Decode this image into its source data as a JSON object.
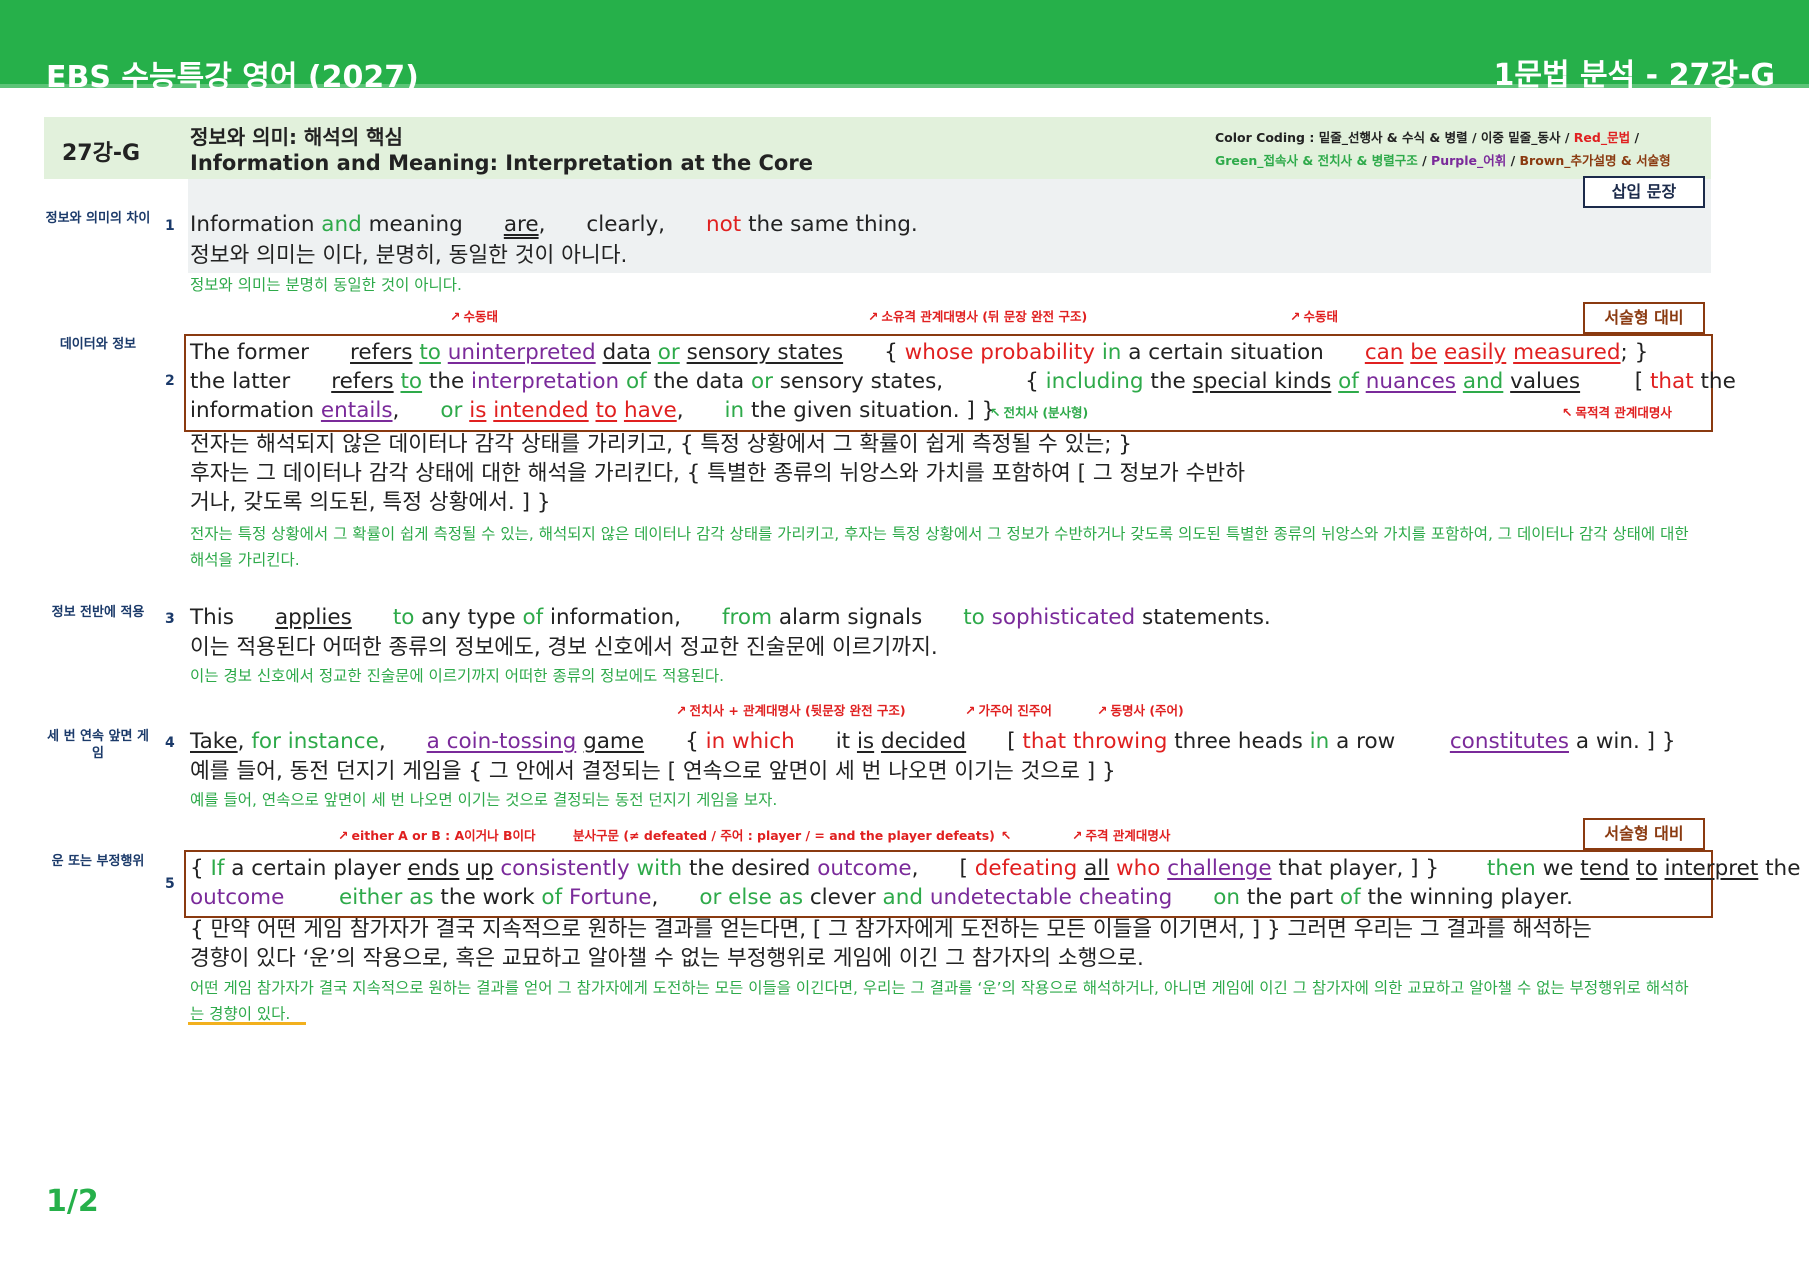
{
  "header": {
    "doc_title": "EBS 수능특강 영어 (2027)",
    "section_title": "1문법 분석 - 27강-G"
  },
  "lesson": {
    "label": "27강-G",
    "title_ko": "정보와 의미: 해석의 핵심",
    "title_en": "Information and Meaning: Interpretation at the Core"
  },
  "color_coding": {
    "line1_black": "Color Coding : 밑줄_선행사 & 수식 & 병렬 / 이중 밑줄_동사 / ",
    "line1_red": "Red_문법",
    "line1_end": " /",
    "line2_green": "Green_접속사 & 전치사 & 병렬구조",
    "sep1": " / ",
    "line2_purple": "Purple_어휘",
    "sep2": " / ",
    "line2_brown": "Brown_추가설명 & 서술형",
    "colors": {
      "green": "#2eaa4a",
      "red": "#e02020",
      "purple": "#7a2a9a",
      "brown": "#8a3a10",
      "navy": "#1b2a4a"
    }
  },
  "tags": {
    "insert": "삽입 문장",
    "essay": "서술형 대비"
  },
  "s1": {
    "topic": "정보와 의미의 차이",
    "num": "1",
    "en": [
      "Information ",
      "and",
      " meaning      ",
      "are",
      ",      clearly,      ",
      "not",
      " the same thing."
    ],
    "ko": [
      "정보와 의미는                       이다,      분명히,       동일한 것이 아니다."
    ],
    "trans": "정보와 의미는 분명히 동일한 것이 아니다."
  },
  "s2": {
    "topic": "데이터와 정보",
    "num": "2",
    "notes": [
      "수동태",
      "소유격 관계대명사 (뒤 문장 완전 구조)",
      "수동태",
      "전치사 (분사형)",
      "목적격 관계대명사"
    ],
    "l1": [
      "The former      ",
      "refers",
      " ",
      "to",
      " ",
      "uninterpreted",
      " ",
      "data",
      " ",
      "or",
      " ",
      "sensory states",
      "      { ",
      "whose probability",
      " ",
      "in",
      " a certain situation      ",
      "can",
      " ",
      "be",
      " ",
      "easily",
      " ",
      "measured",
      "; }"
    ],
    "l2": [
      "the latter      ",
      "refers",
      " ",
      "to",
      " the ",
      "interpretation",
      " ",
      "of",
      " the data ",
      "or",
      " sensory states,            { ",
      "including",
      " the ",
      "special kinds",
      " ",
      "of",
      " ",
      "nuances",
      " ",
      "and",
      " ",
      "values",
      "        [ ",
      "that",
      " the"
    ],
    "l3": [
      "information ",
      "entails",
      ",      ",
      "or",
      " ",
      "is",
      " ",
      "intended",
      " ",
      "to",
      " ",
      "have",
      ",      ",
      "in",
      " the given situation. ] }"
    ],
    "ko1": "전자는             해석되지 않은 데이터나 감각 상태를 가리키고,             { 특정 상황에서 그 확률이                              쉽게 측정될 수 있는; }",
    "ko2": "후자는          그 데이터나 감각 상태에 대한 해석을 가리킨다,                            { 특별한 종류의 뉘앙스와 가치를 포함하여                            [ 그 정보가 수반하",
    "ko3": "거나,                 갖도록 의도된,                    특정 상황에서. ] }",
    "trans": "전자는 특정 상황에서 그 확률이 쉽게 측정될 수 있는, 해석되지 않은 데이터나 감각 상태를 가리키고, 후자는 특정 상황에서 그 정보가 수반하거나 갖도록 의도된 특별한 종류의 뉘앙스와 가치를 포함하여, 그 데이터나 감각 상태에 대한 해석을 가리킨다."
  },
  "s3": {
    "topic": "정보 전반에 적용",
    "num": "3",
    "en": [
      "This      ",
      "applies",
      "      ",
      "to",
      " any type ",
      "of",
      " information,      ",
      "from",
      " alarm signals      ",
      "to",
      " ",
      "sophisticated",
      " statements."
    ],
    "ko": "이는       적용된다      어떠한 종류의 정보에도,              경보 신호에서              정교한 진술문에 이르기까지.",
    "trans": "이는 경보 신호에서 정교한 진술문에 이르기까지 어떠한 종류의 정보에도 적용된다."
  },
  "s4": {
    "topic": "세 번 연속 앞면 게임",
    "num": "4",
    "notes": [
      "전치사 + 관계대명사 (뒷문장 완전 구조)",
      "가주어 진주어",
      "동명사 (주어)"
    ],
    "en": [
      "Take",
      ", ",
      "for instance",
      ",      ",
      "a coin-tossing",
      " ",
      "game",
      "      { ",
      "in which",
      "      it ",
      "is",
      " ",
      "decided",
      "      [ ",
      "that",
      " ",
      "throwing",
      " three heads ",
      "in",
      " a row        ",
      "constitutes",
      " a win. ] }"
    ],
    "ko": "예를 들어,                   동전 던지기 게임을            { 그 안에서      결정되는            [ 연속으로 앞면이 세 번 나오면                    이기는 것으로 ] }",
    "trans": "예를 들어, 연속으로 앞면이 세 번 나오면 이기는 것으로 결정되는 동전 던지기 게임을 보자."
  },
  "s5": {
    "topic": "운 또는 부정행위",
    "num": "5",
    "notes": [
      "either A or B : A이거나 B이다",
      "분사구문 (≠ defeated / 주어 : player / = and the player defeats)",
      "주격 관계대명사"
    ],
    "l1": [
      "{ ",
      "If",
      " a certain player ",
      "ends",
      " ",
      "up",
      " ",
      "consistently",
      " ",
      "with",
      " the desired ",
      "outcome",
      ",      [ ",
      "defeating",
      " ",
      "all",
      " ",
      "who",
      " ",
      "challenge",
      " that player, ] }       ",
      "then",
      " we ",
      "tend",
      " ",
      "to",
      " ",
      "interpret",
      " the"
    ],
    "l2": [
      "outcome",
      "        ",
      "either as",
      " the work ",
      "of",
      " ",
      "Fortune",
      ",      ",
      "or else as",
      " clever ",
      "and",
      " ",
      "undetectable cheating",
      "      ",
      "on",
      " the part ",
      "of",
      " the winning player."
    ],
    "ko1": "{ 만약 어떤 게임 참가자가 결국 지속적으로 원하는 결과를 얻는다면,                  [ 그 참가자에게 도전하는 모든 이들을 이기면서, ] }      그러면 우리는 그 결과를 해석하는",
    "ko2": "경향이 있다      ‘운’의 작용으로,                          혹은 교묘하고 알아챌 수 없는 부정행위로                  게임에 이긴 그 참가자의 소행으로.",
    "trans": "어떤 게임 참가자가 결국 지속적으로 원하는 결과를 얻어 그 참가자에게 도전하는 모든 이들을 이긴다면, 우리는 그 결과를 ‘운’의 작용으로 해석하거나, 아니면 게임에 이긴 그 참가자에 의한 교묘하고 알아챌 수 없는 부정행위로 해석하는 경향이 있다."
  },
  "footer": {
    "page": "1/2"
  }
}
